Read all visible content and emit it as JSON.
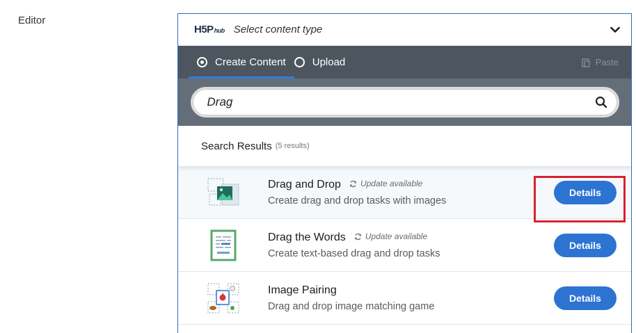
{
  "field_label": "Editor",
  "hub": {
    "logo_main": "H5P",
    "logo_sub": "hub",
    "header_title": "Select content type"
  },
  "tabs": [
    {
      "label": "Create Content",
      "selected": true
    },
    {
      "label": "Upload",
      "selected": false
    }
  ],
  "paste_label": "Paste",
  "search": {
    "value": "Drag"
  },
  "results": {
    "title": "Search Results",
    "count": "(5 results)"
  },
  "items": [
    {
      "title": "Drag and Drop",
      "update": "Update available",
      "description": "Create drag and drop tasks with images",
      "button": "Details",
      "icon": "drag-and-drop-icon"
    },
    {
      "title": "Drag the Words",
      "update": "Update available",
      "description": "Create text-based drag and drop tasks",
      "button": "Details",
      "icon": "drag-the-words-icon"
    },
    {
      "title": "Image Pairing",
      "update": "",
      "description": "Drag and drop image matching game",
      "button": "Details",
      "icon": "image-pairing-icon"
    }
  ],
  "colors": {
    "accent": "#2d73d1",
    "tabs_bg": "#4d565f",
    "search_bg": "#646e78",
    "highlight_border": "#d72230"
  }
}
